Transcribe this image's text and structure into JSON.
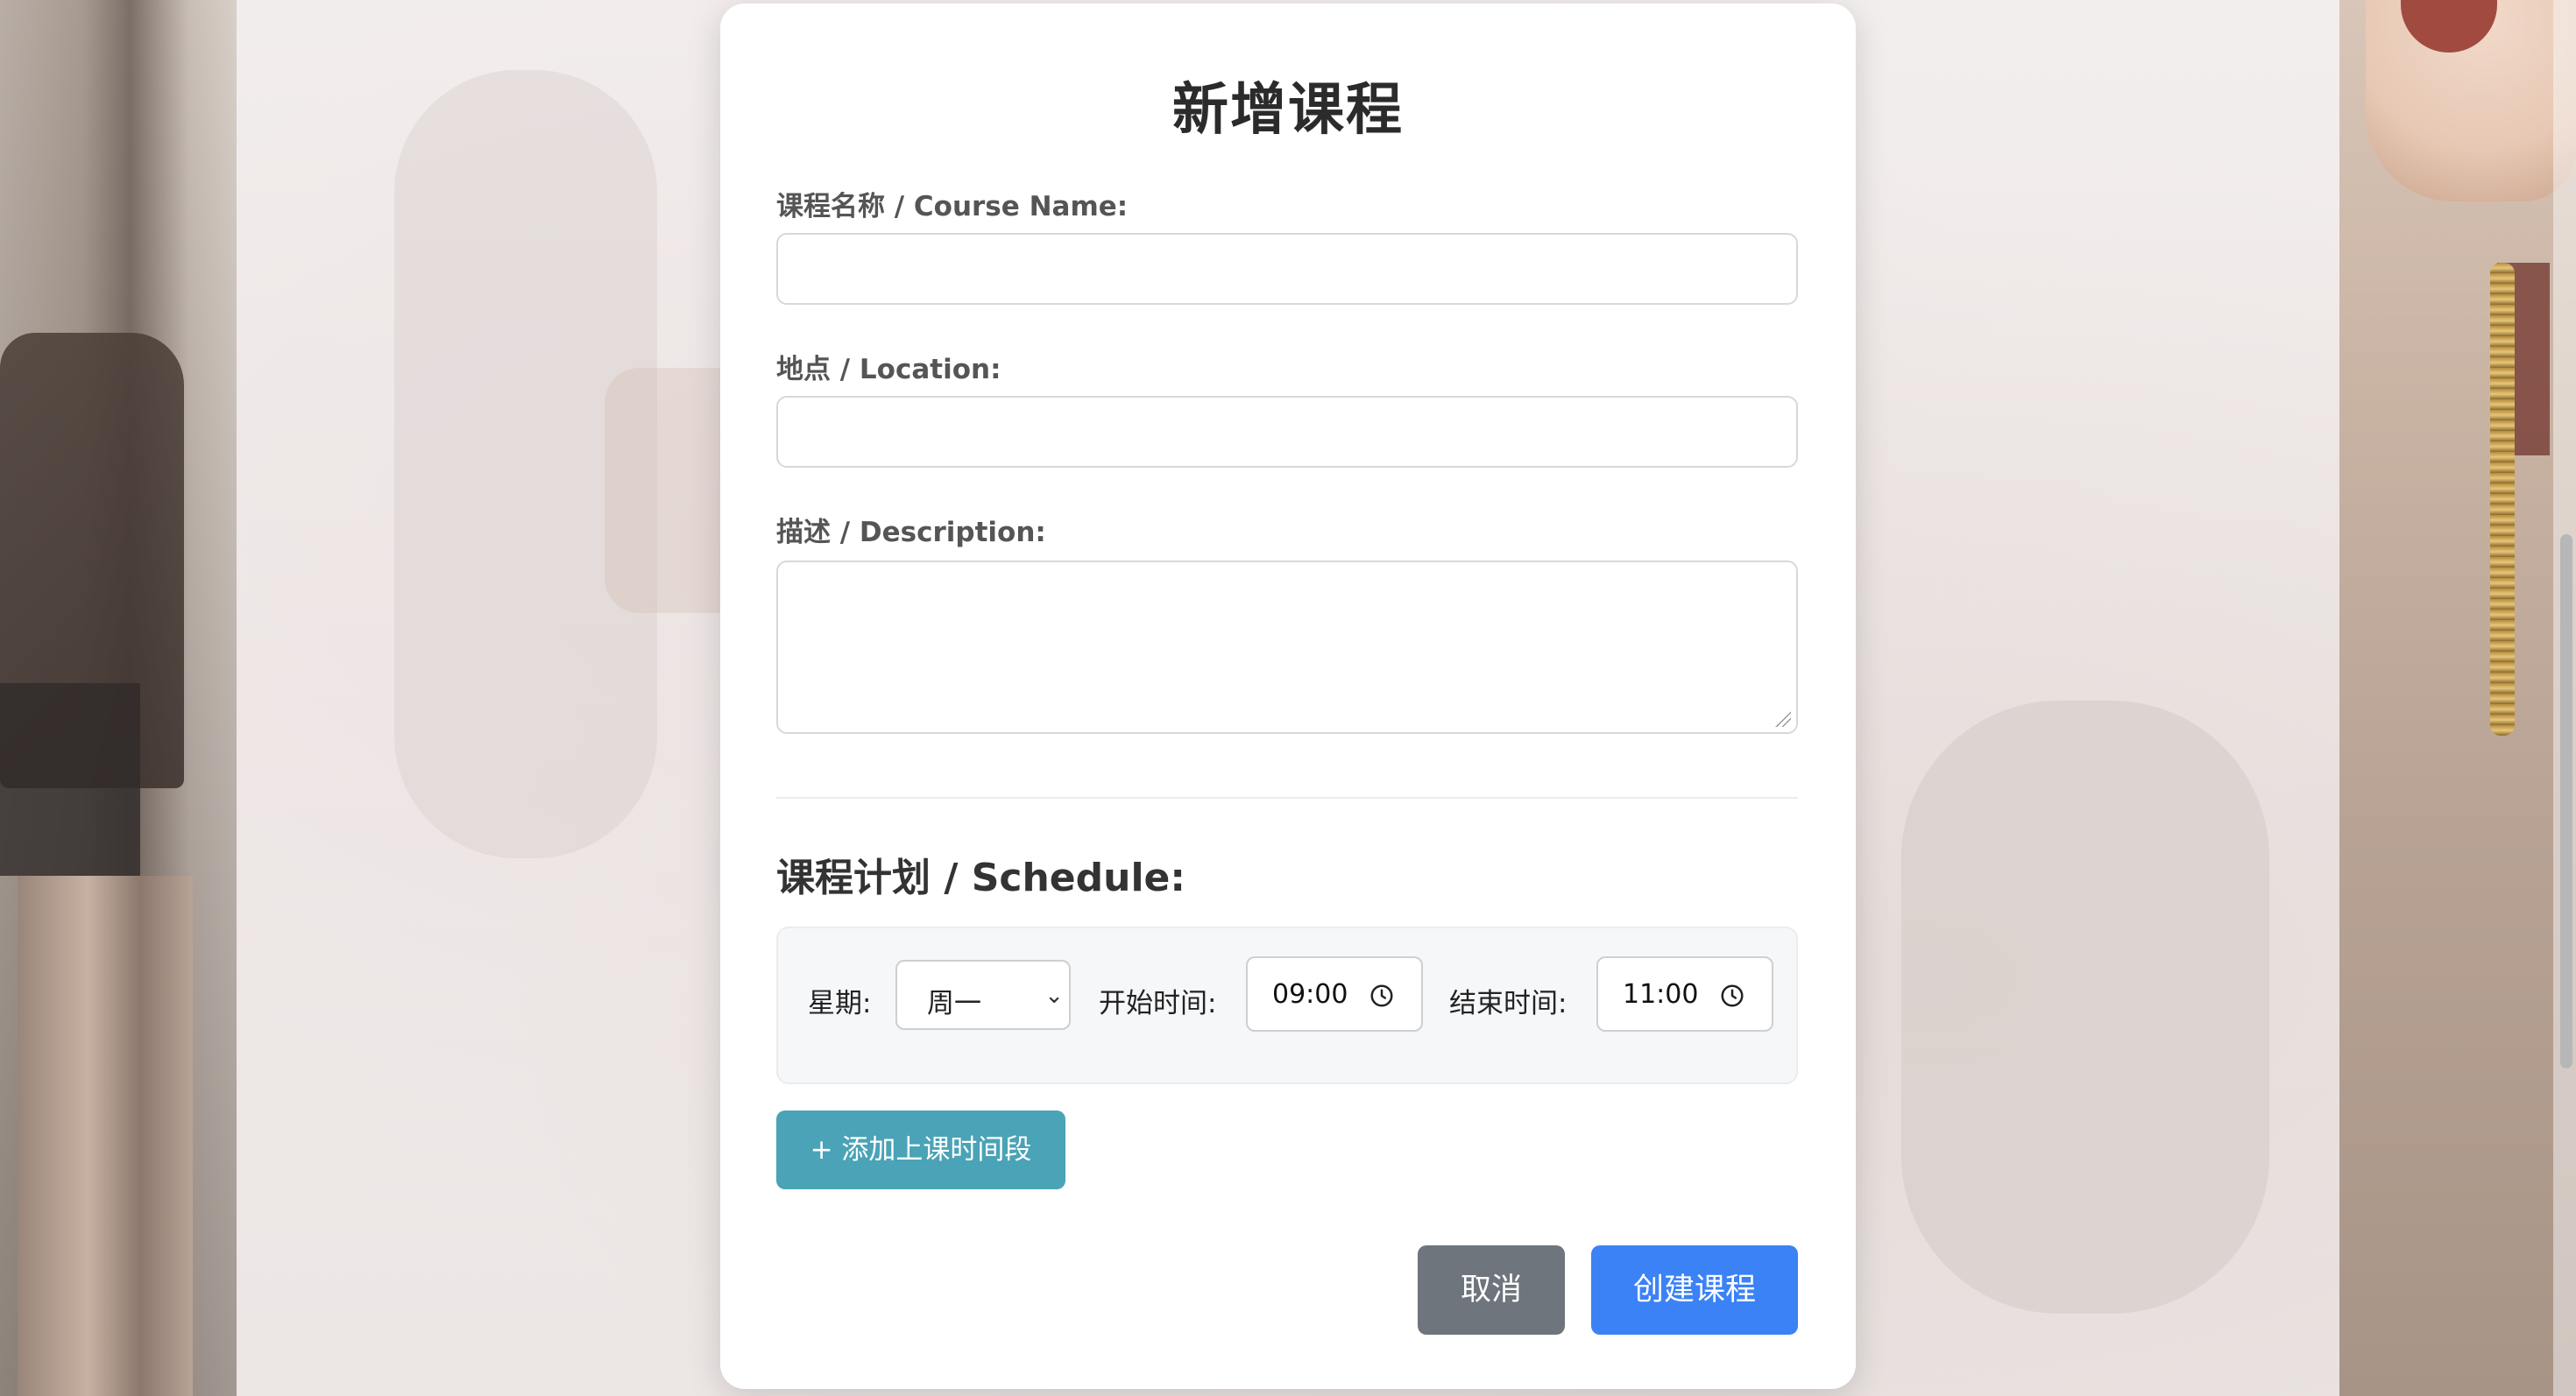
{
  "modal": {
    "title": "新增课程"
  },
  "form": {
    "course_name": {
      "label": "课程名称 / Course Name:",
      "value": "",
      "placeholder": ""
    },
    "location": {
      "label": "地点 / Location:",
      "value": "",
      "placeholder": ""
    },
    "description": {
      "label": "描述 / Description:",
      "value": "",
      "placeholder": ""
    }
  },
  "schedule": {
    "title": "课程计划 / Schedule:",
    "rows": [
      {
        "weekday_label": "星期:",
        "weekday_value": "周一",
        "start_label": "开始时间:",
        "start_value": "09:00",
        "end_label": "结束时间:",
        "end_value": "11:00"
      }
    ],
    "add_button": "+ 添加上课时间段"
  },
  "actions": {
    "cancel": "取消",
    "create": "创建课程"
  },
  "colors": {
    "add_button": "#4aa3b6",
    "cancel_button": "#6e757c",
    "create_button": "#3b82f6"
  },
  "icons": {
    "clock": "clock-icon",
    "chevron": "chevron-down-icon"
  }
}
